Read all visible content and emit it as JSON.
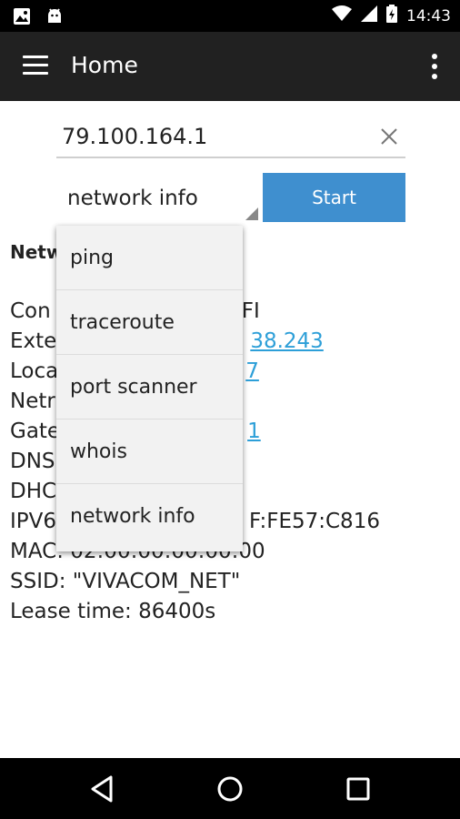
{
  "status_bar": {
    "time": "14:43",
    "left_icons": [
      "image-icon",
      "android-icon"
    ],
    "right_icons": [
      "wifi-icon",
      "signal-icon",
      "battery-charging-icon"
    ]
  },
  "toolbar": {
    "title": "Home",
    "menu_icon": "hamburger-menu-icon",
    "overflow_icon": "more-vert-icon"
  },
  "host_input": {
    "value": "79.100.164.1",
    "clear_icon": "close-icon"
  },
  "tool_spinner": {
    "selected": "network info"
  },
  "start_button": {
    "label": "Start",
    "color": "#3f8fcf"
  },
  "dropdown": {
    "options": [
      "ping",
      "traceroute",
      "port scanner",
      "whois",
      "network info"
    ]
  },
  "info": {
    "heading": "Netw",
    "lines": [
      {
        "text": "Con",
        "suffix": "FI"
      },
      {
        "text": "Exte",
        "link": "38.243"
      },
      {
        "text": "Loca",
        "link": "7"
      },
      {
        "text": "Netr",
        "suffix": ""
      },
      {
        "text": "Gate",
        "link": "1"
      },
      {
        "text": "DNS",
        "suffix": ""
      },
      {
        "text": "DHC",
        "suffix": ""
      },
      {
        "text": "IPV6",
        "suffix": "F:FE57:C816"
      },
      {
        "text": "MAC: 02:00:00:00:00:00"
      },
      {
        "text": "SSID: \"VIVACOM_NET\""
      },
      {
        "text": "Lease time: 86400s"
      }
    ],
    "link_color": "#2d9fd8"
  },
  "nav_bar": {
    "icons": [
      "back-icon",
      "home-icon",
      "recents-icon"
    ]
  }
}
